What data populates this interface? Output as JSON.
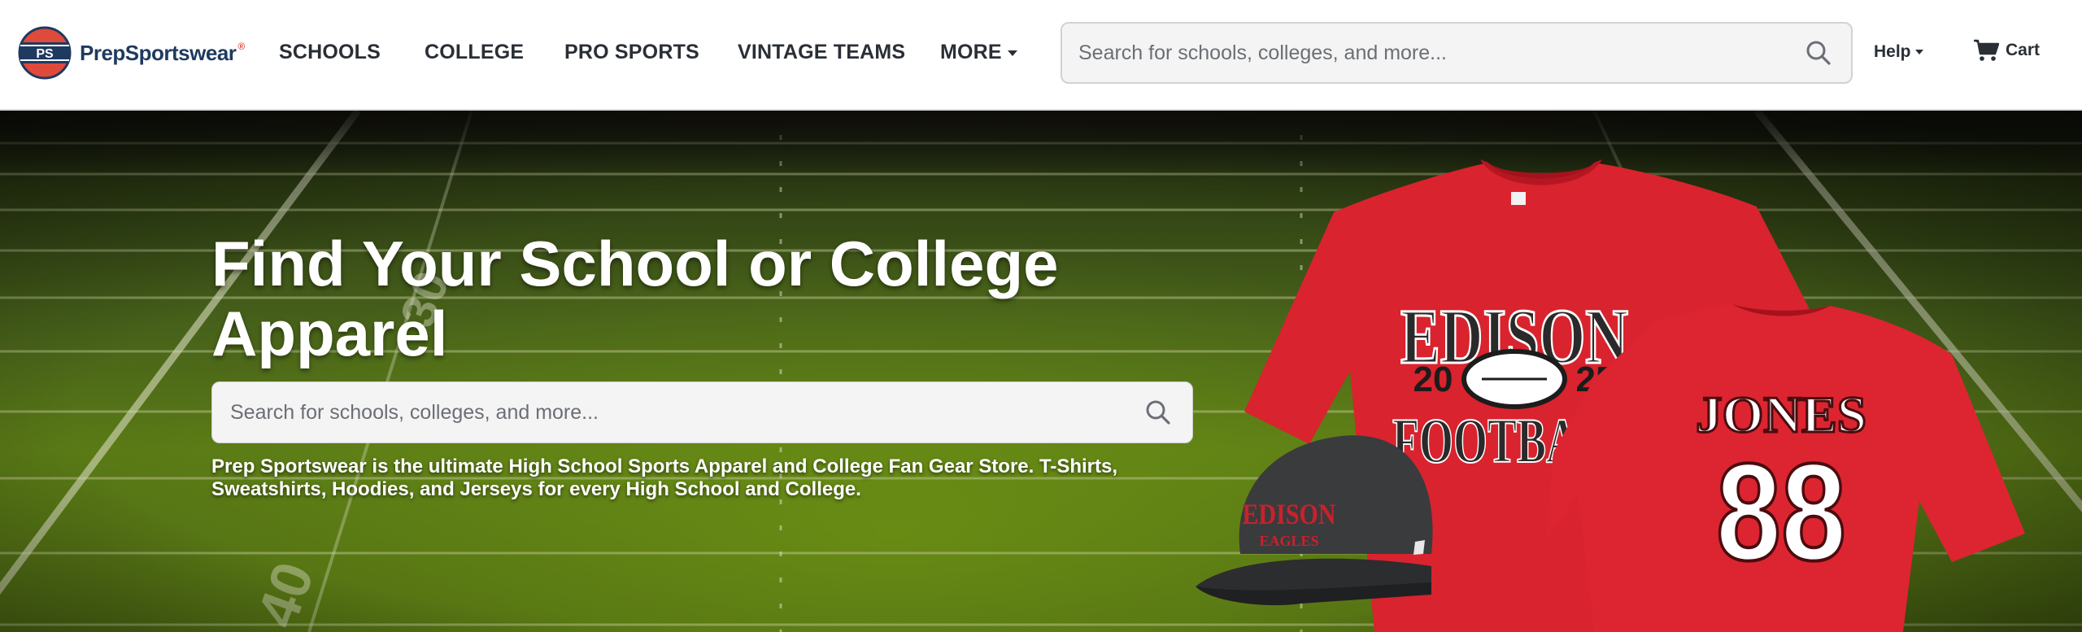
{
  "header": {
    "logo": {
      "name": "PrepSportswear",
      "mark": "PS",
      "registered": "®"
    },
    "nav": [
      {
        "label": "SCHOOLS"
      },
      {
        "label": "COLLEGE"
      },
      {
        "label": "PRO SPORTS"
      },
      {
        "label": "VINTAGE TEAMS"
      },
      {
        "label": "MORE"
      }
    ],
    "search": {
      "placeholder": "Search for schools, colleges, and more..."
    },
    "help_label": "Help",
    "cart_label": "Cart"
  },
  "hero": {
    "title": "Find Your School or College Apparel",
    "search": {
      "placeholder": "Search for schools, colleges, and more..."
    },
    "description": "Prep Sportswear is the ultimate High School Sports Apparel and College Fan Gear Store. T-Shirts, Sweatshirts, Hoodies, and Jerseys for every High School and College.",
    "products": {
      "shirt_front": {
        "line1": "EDISON",
        "year_left": "20",
        "year_right": "25",
        "line2": "FOOTBALL"
      },
      "shirt_back": {
        "name": "JONES",
        "number": "88"
      },
      "hat": {
        "line1": "EDISON",
        "line2": "EAGLES"
      },
      "field_numbers": [
        "30",
        "40"
      ]
    }
  },
  "colors": {
    "brand_navy": "#1f3a5f",
    "brand_red": "#e04a3a",
    "shirt_red": "#d9232e",
    "field_green": "#5a7a16"
  }
}
